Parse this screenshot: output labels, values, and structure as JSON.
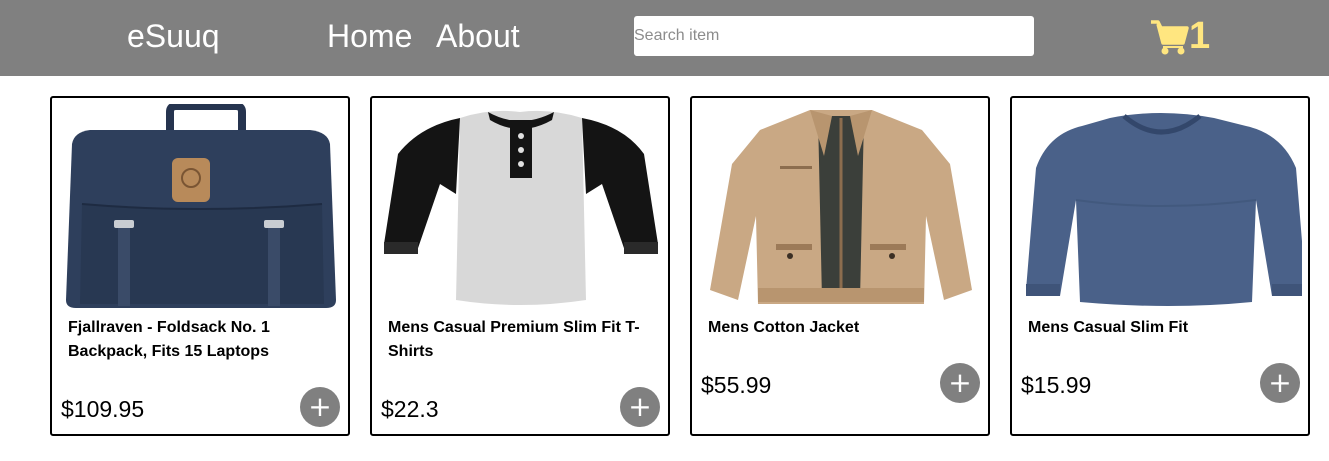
{
  "navbar": {
    "brand": "eSuuq",
    "links": [
      "Home",
      "About"
    ],
    "search_placeholder": "Search item",
    "search_value": "",
    "cart_count": "1",
    "cart_icon": "shopping-cart-icon"
  },
  "colors": {
    "navbar_bg": "#808080",
    "cart_accent": "#ffe680",
    "add_button_bg": "#808080",
    "card_border": "#000000"
  },
  "products": [
    {
      "title": "Fjallraven - Foldsack No. 1 Backpack, Fits 15 Laptops",
      "price": "$109.95",
      "image": "navy-backpack"
    },
    {
      "title": "Mens Casual Premium Slim Fit T-Shirts",
      "price": "$22.3",
      "image": "raglan-henley-tshirt"
    },
    {
      "title": "Mens Cotton Jacket",
      "price": "$55.99",
      "image": "khaki-cotton-jacket"
    },
    {
      "title": "Mens Casual Slim Fit",
      "price": "$15.99",
      "image": "blue-long-sleeve-shirt"
    }
  ],
  "add_label": "+"
}
